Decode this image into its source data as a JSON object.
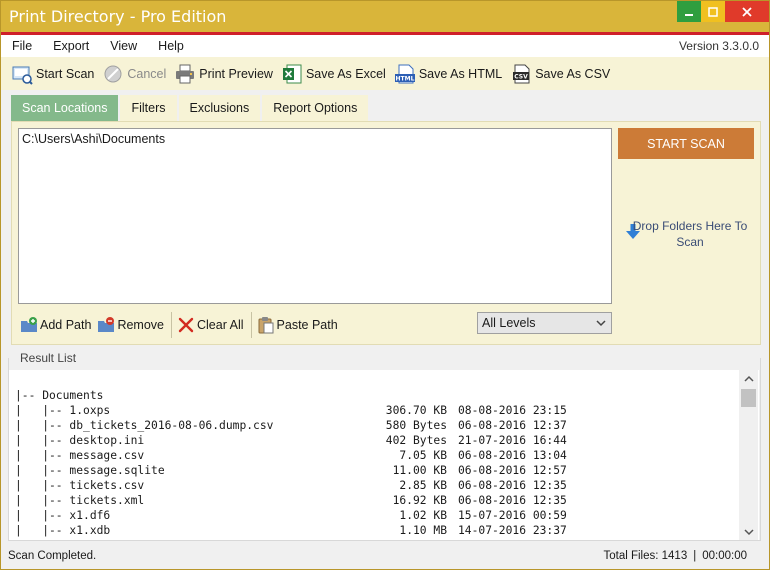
{
  "window": {
    "title": "Print Directory - Pro Edition",
    "colors": {
      "titlebar": "#d9b53a",
      "accent": "#cf1f2a",
      "active_tab": "#84b98b",
      "start_button": "#cc7b37",
      "toolbar_bg": "#f7f3d6"
    }
  },
  "menu": {
    "items": [
      "File",
      "Export",
      "View",
      "Help"
    ],
    "version": "Version 3.3.0.0"
  },
  "toolbar": {
    "start_scan": "Start Scan",
    "cancel": "Cancel",
    "print_preview": "Print Preview",
    "save_excel": "Save As Excel",
    "save_html": "Save As HTML",
    "save_csv": "Save As CSV"
  },
  "tabs": [
    "Scan Locations",
    "Filters",
    "Exclusions",
    "Report Options"
  ],
  "scan": {
    "paths": [
      "C:\\Users\\Ashi\\Documents"
    ],
    "start_button": "START SCAN",
    "drop_hint": "Drop Folders Here To Scan",
    "actions": {
      "add_path": "Add Path",
      "remove": "Remove",
      "clear_all": "Clear All",
      "paste_path": "Paste Path"
    },
    "levels_selected": "All Levels"
  },
  "results": {
    "label": "Result List",
    "rows": [
      {
        "name": "|-- Documents",
        "size": "",
        "date": ""
      },
      {
        "name": "|   |-- 1.oxps",
        "size": "306.70 KB",
        "date": "08-08-2016 23:15"
      },
      {
        "name": "|   |-- db_tickets_2016-08-06.dump.csv",
        "size": "580 Bytes",
        "date": "06-08-2016 12:37"
      },
      {
        "name": "|   |-- desktop.ini",
        "size": "402 Bytes",
        "date": "21-07-2016 16:44"
      },
      {
        "name": "|   |-- message.csv",
        "size": "7.05 KB",
        "date": "06-08-2016 13:04"
      },
      {
        "name": "|   |-- message.sqlite",
        "size": "11.00 KB",
        "date": "06-08-2016 12:57"
      },
      {
        "name": "|   |-- tickets.csv",
        "size": "2.85 KB",
        "date": "06-08-2016 12:35"
      },
      {
        "name": "|   |-- tickets.xml",
        "size": "16.92 KB",
        "date": "06-08-2016 12:35"
      },
      {
        "name": "|   |-- x1.df6",
        "size": "1.02 KB",
        "date": "15-07-2016 00:59"
      },
      {
        "name": "|   |-- x1.xdb",
        "size": "1.10 MB",
        "date": "14-07-2016 23:37"
      }
    ]
  },
  "status": {
    "message": "Scan Completed.",
    "total_files": "Total Files: 1413",
    "separator": "|",
    "elapsed": "00:00:00"
  }
}
